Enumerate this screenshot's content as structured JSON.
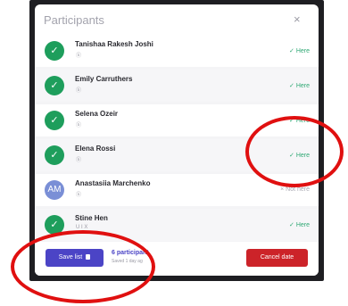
{
  "modal": {
    "title": "Participants",
    "close_symbol": "×"
  },
  "participants": [
    {
      "name": "Tanishaa Rakesh Joshi",
      "sub": "ⓑ",
      "avatar": "✓",
      "avatar_type": "check",
      "status": "✓  Here"
    },
    {
      "name": "Emily Carruthers",
      "sub": "ⓑ",
      "avatar": "✓",
      "avatar_type": "check",
      "status": "✓  Here"
    },
    {
      "name": "Selena Ozeir",
      "sub": "ⓑ",
      "avatar": "✓",
      "avatar_type": "check",
      "status": "✓  Here"
    },
    {
      "name": "Elena Rossi",
      "sub": "ⓑ",
      "avatar": "✓",
      "avatar_type": "check",
      "status": "✓  Here"
    },
    {
      "name": "Anastasiia Marchenko",
      "sub": "ⓑ",
      "avatar": "AM",
      "avatar_type": "initials",
      "status": "×  Not here"
    },
    {
      "name": "Stine Hen",
      "sub": "U I X",
      "avatar": "✓",
      "avatar_type": "check",
      "status": "✓  Here"
    }
  ],
  "footer": {
    "save_label": "Save list",
    "count_label": "6 participant",
    "saved_label": "Saved 1 day ag",
    "cancel_label": "Cancel date"
  },
  "colors": {
    "accent": "#4b44c6",
    "present": "#1e9e5c",
    "danger": "#cc2329",
    "annotation": "#e01010"
  }
}
